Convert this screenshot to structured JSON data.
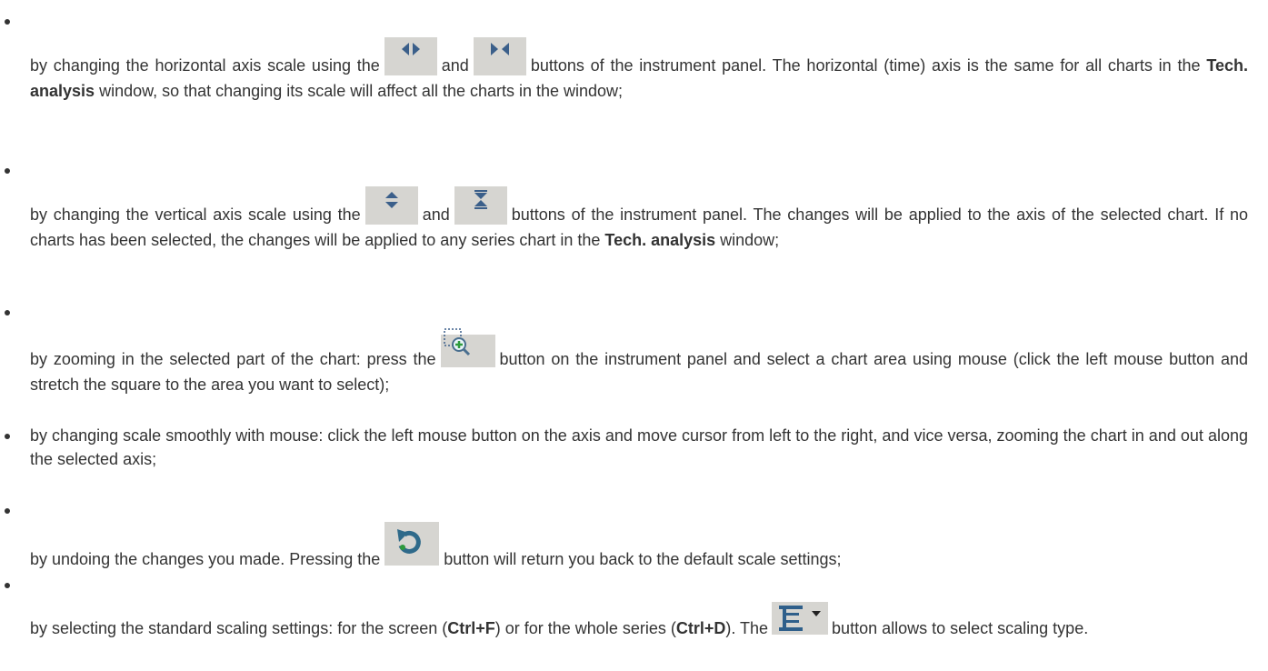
{
  "items": [
    {
      "before": "by changing the horizontal axis scale using the",
      "and": "and",
      "after": "buttons of the instrument panel. The horizontal (time) axis is the same for all charts in the",
      "bold1": "Tech. analysis",
      "after2": "window, so that changing its scale will affect all the charts in the window;",
      "icon1": "horizontal-expand-icon",
      "icon2": "horizontal-shrink-icon"
    },
    {
      "before": "by changing the vertical axis scale using the",
      "and": "and",
      "after": "buttons of the instrument panel. The changes will be applied to the axis of the selected chart. If no charts has been selected, the changes will be applied to any series chart in the",
      "bold1": "Tech. analysis",
      "after2": "window;",
      "icon1": "vertical-expand-icon",
      "icon2": "vertical-shrink-icon"
    },
    {
      "before": "by zooming in the selected part of the chart: press the",
      "after": "button on the instrument panel and select a chart area using mouse (click the left mouse button and stretch the square to the area you want to select);",
      "icon1": "zoom-area-icon"
    },
    {
      "text": "by changing scale smoothly with mouse: click the left mouse button on the axis and move cursor from left to the right, and vice versa, zooming the chart in and out along the selected axis;"
    },
    {
      "before": "by undoing the changes you made. Pressing the",
      "after": "button will return you back to the default scale settings;",
      "icon1": "undo-icon"
    },
    {
      "before": "by selecting the standard scaling settings: for the screen (",
      "bold1": "Ctrl+F",
      "mid": ") or for the whole series (",
      "bold2": "Ctrl+D",
      "after": "). The",
      "after2": "button allows to select scaling type.",
      "icon1": "scaling-type-dropdown-icon"
    }
  ]
}
